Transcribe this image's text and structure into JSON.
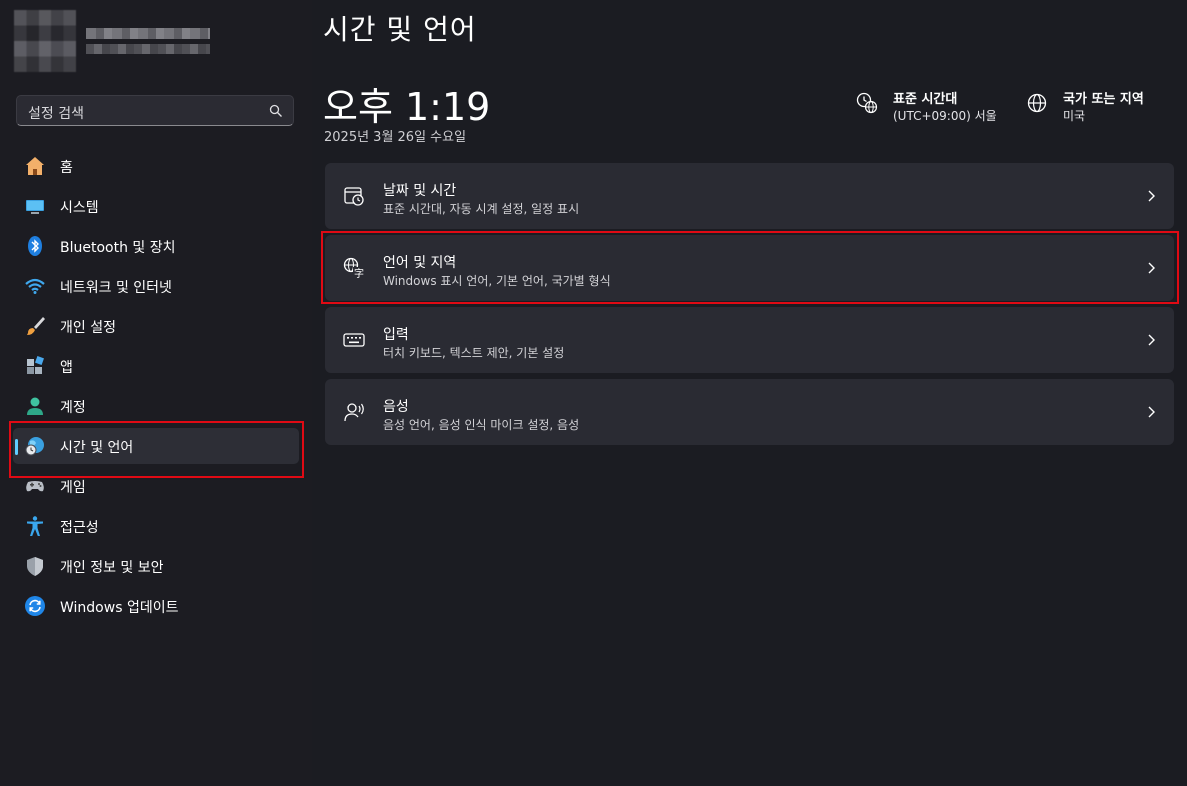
{
  "search": {
    "placeholder": "설정 검색",
    "icon": "search-icon"
  },
  "sidebar": {
    "items": [
      {
        "label": "홈",
        "icon": "home-icon"
      },
      {
        "label": "시스템",
        "icon": "system-display-icon"
      },
      {
        "label": "Bluetooth 및 장치",
        "icon": "bluetooth-icon"
      },
      {
        "label": "네트워크 및 인터넷",
        "icon": "wifi-icon"
      },
      {
        "label": "개인 설정",
        "icon": "paintbrush-icon"
      },
      {
        "label": "앱",
        "icon": "apps-icon"
      },
      {
        "label": "계정",
        "icon": "account-icon"
      },
      {
        "label": "시간 및 언어",
        "icon": "time-language-icon",
        "selected": true
      },
      {
        "label": "게임",
        "icon": "gamepad-icon"
      },
      {
        "label": "접근성",
        "icon": "accessibility-icon"
      },
      {
        "label": "개인 정보 및 보안",
        "icon": "shield-icon"
      },
      {
        "label": "Windows 업데이트",
        "icon": "windows-update-icon"
      }
    ]
  },
  "main": {
    "title": "시간 및 언어",
    "time": "오후 1:19",
    "date": "2025년 3월 26일 수요일",
    "timezone": {
      "label": "표준 시간대",
      "value": "(UTC+09:00) 서울"
    },
    "region": {
      "label": "국가 또는 지역",
      "value": "미국"
    },
    "cards": [
      {
        "title": "날짜 및 시간",
        "subtitle": "표준 시간대, 자동 시계 설정, 일정 표시",
        "icon": "calendar-clock-icon"
      },
      {
        "title": "언어 및 지역",
        "subtitle": "Windows 표시 언어, 기본 언어, 국가별 형식",
        "icon": "language-icon"
      },
      {
        "title": "입력",
        "subtitle": "터치 키보드, 텍스트 제안, 기본 설정",
        "icon": "keyboard-icon"
      },
      {
        "title": "음성",
        "subtitle": "음성 언어, 음성 인식 마이크 설정, 음성",
        "icon": "speech-icon"
      }
    ]
  },
  "colors": {
    "accent": "#60cdff",
    "highlight": "#e00a14"
  }
}
